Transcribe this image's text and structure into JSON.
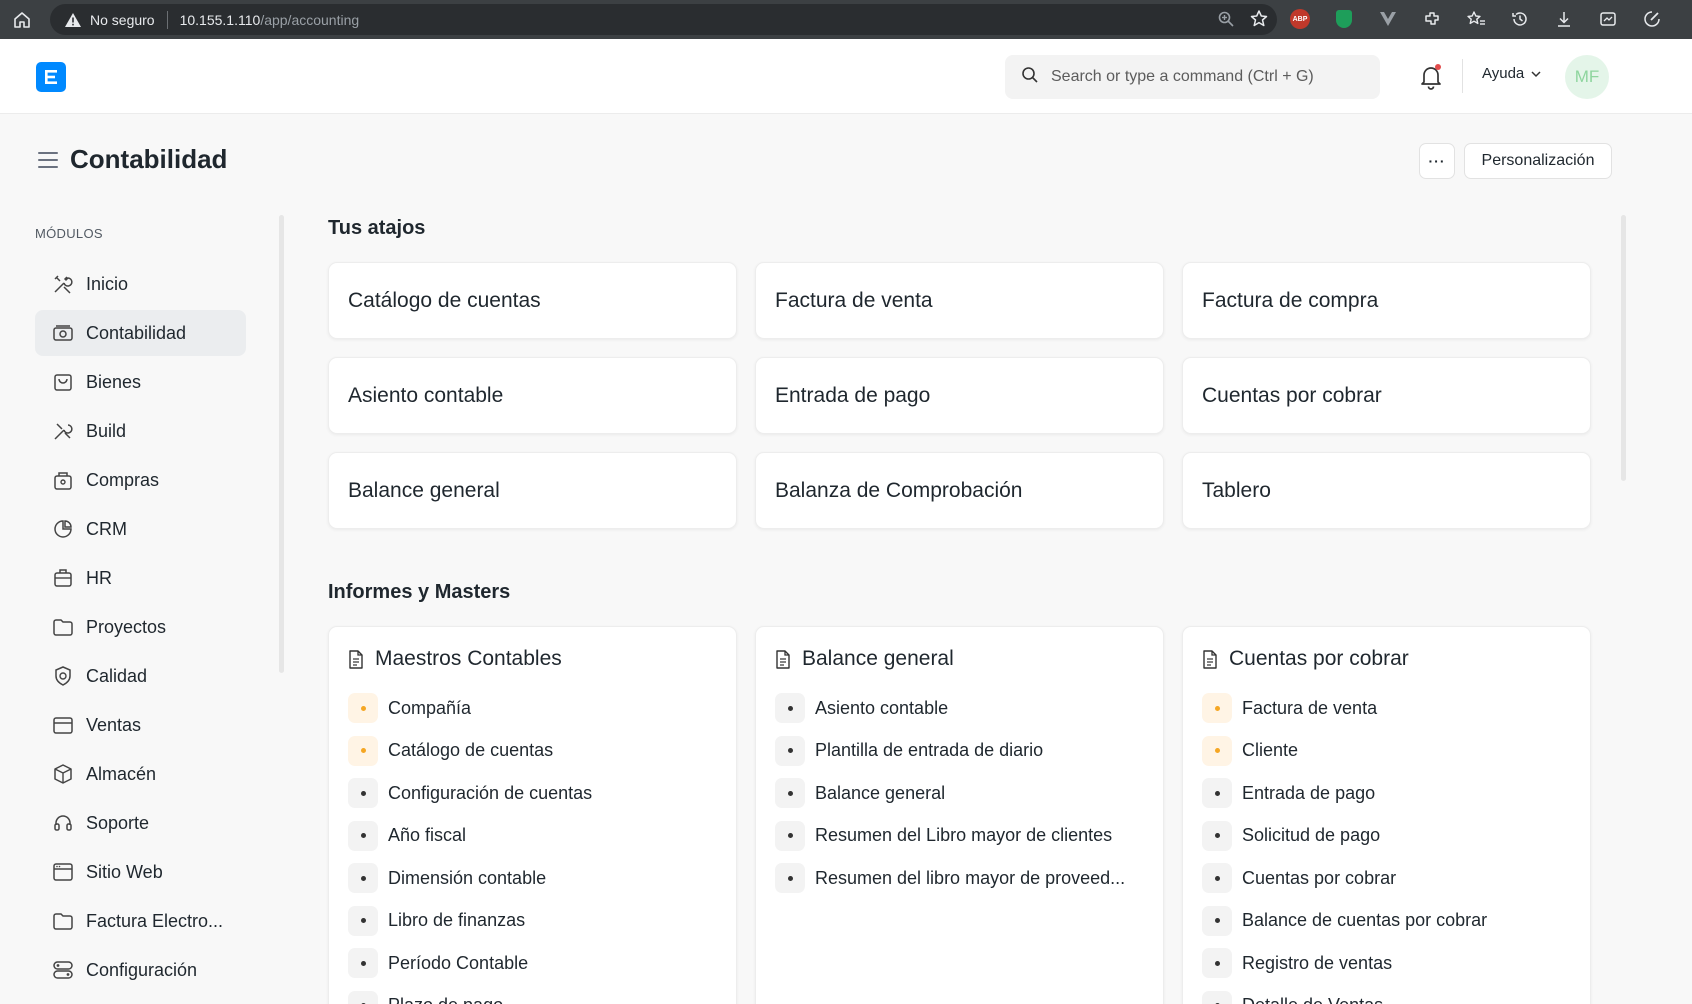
{
  "browser": {
    "security_label": "No seguro",
    "url_host": "10.155.1.110",
    "url_path": "/app/accounting"
  },
  "navbar": {
    "search_placeholder": "Search or type a command (Ctrl + G)",
    "help_label": "Ayuda",
    "avatar_initials": "MF",
    "accent_color": "#0089ff"
  },
  "page": {
    "title": "Contabilidad",
    "more_label": "···",
    "customize_label": "Personalización"
  },
  "sidebar": {
    "title": "MÓDULOS",
    "items": [
      {
        "label": "Inicio",
        "icon": "tools-icon"
      },
      {
        "label": "Contabilidad",
        "icon": "money-icon",
        "active": true
      },
      {
        "label": "Bienes",
        "icon": "bag-icon"
      },
      {
        "label": "Build",
        "icon": "build-icon"
      },
      {
        "label": "Compras",
        "icon": "shopping-icon"
      },
      {
        "label": "CRM",
        "icon": "crm-icon"
      },
      {
        "label": "HR",
        "icon": "hr-icon"
      },
      {
        "label": "Proyectos",
        "icon": "folder-icon"
      },
      {
        "label": "Calidad",
        "icon": "quality-icon"
      },
      {
        "label": "Ventas",
        "icon": "sales-icon"
      },
      {
        "label": "Almacén",
        "icon": "box-icon"
      },
      {
        "label": "Soporte",
        "icon": "headset-icon"
      },
      {
        "label": "Sitio Web",
        "icon": "website-icon"
      },
      {
        "label": "Factura Electro...",
        "icon": "folder-icon"
      },
      {
        "label": "Configuración",
        "icon": "settings-icon"
      }
    ]
  },
  "shortcuts": {
    "title": "Tus atajos",
    "items": [
      "Catálogo de cuentas",
      "Factura de venta",
      "Factura de compra",
      "Asiento contable",
      "Entrada de pago",
      "Cuentas por cobrar",
      "Balance general",
      "Balanza de Comprobación",
      "Tablero"
    ]
  },
  "reports": {
    "title": "Informes y Masters",
    "cards": [
      {
        "title": "Maestros Contables",
        "links": [
          {
            "label": "Compañía",
            "highlight": true
          },
          {
            "label": "Catálogo de cuentas",
            "highlight": true
          },
          {
            "label": "Configuración de cuentas",
            "highlight": false
          },
          {
            "label": "Año fiscal",
            "highlight": false
          },
          {
            "label": "Dimensión contable",
            "highlight": false
          },
          {
            "label": "Libro de finanzas",
            "highlight": false
          },
          {
            "label": "Período Contable",
            "highlight": false
          },
          {
            "label": "Plazo de pago",
            "highlight": false
          }
        ]
      },
      {
        "title": "Balance general",
        "links": [
          {
            "label": "Asiento contable",
            "highlight": false
          },
          {
            "label": "Plantilla de entrada de diario",
            "highlight": false
          },
          {
            "label": "Balance general",
            "highlight": false
          },
          {
            "label": "Resumen del Libro mayor de clientes",
            "highlight": false
          },
          {
            "label": "Resumen del libro mayor de proveed...",
            "highlight": false
          }
        ]
      },
      {
        "title": "Cuentas por cobrar",
        "links": [
          {
            "label": "Factura de venta",
            "highlight": true
          },
          {
            "label": "Cliente",
            "highlight": true
          },
          {
            "label": "Entrada de pago",
            "highlight": false
          },
          {
            "label": "Solicitud de pago",
            "highlight": false
          },
          {
            "label": "Cuentas por cobrar",
            "highlight": false
          },
          {
            "label": "Balance de cuentas por cobrar",
            "highlight": false
          },
          {
            "label": "Registro de ventas",
            "highlight": false
          },
          {
            "label": "Detalle de Ventas",
            "highlight": false
          }
        ]
      }
    ]
  }
}
